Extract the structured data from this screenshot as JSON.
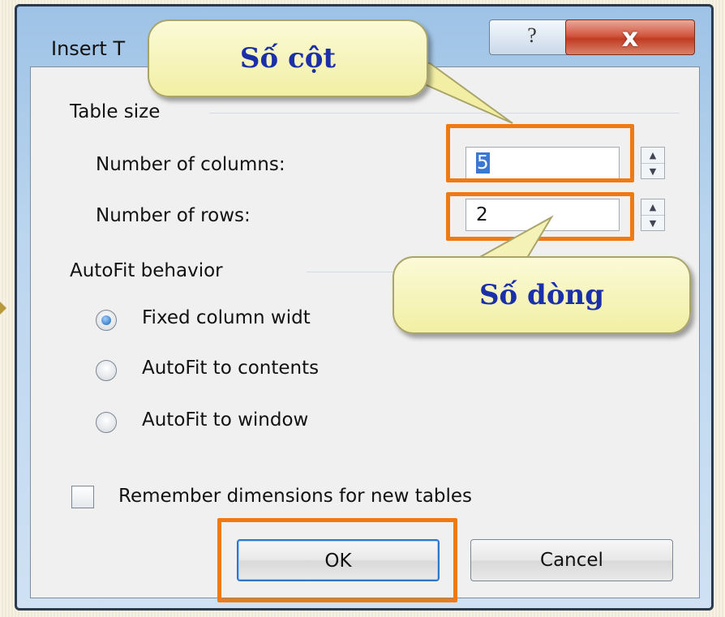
{
  "dialog": {
    "title": "Insert T",
    "help_glyph": "?",
    "close_glyph": "x"
  },
  "table_size": {
    "group_label": "Table size",
    "columns_label": "Number of columns:",
    "columns_value": "5",
    "rows_label": "Number of rows:",
    "rows_value": "2"
  },
  "autofit": {
    "group_label": "AutoFit behavior",
    "options": [
      {
        "label": "Fixed column widt",
        "selected": true
      },
      {
        "label": "AutoFit to contents",
        "selected": false
      },
      {
        "label": "AutoFit to window",
        "selected": false
      }
    ]
  },
  "remember": {
    "label": "Remember dimensions for new tables",
    "checked": false
  },
  "buttons": {
    "ok": "OK",
    "cancel": "Cancel"
  },
  "callouts": {
    "columns": "Số cột",
    "rows": "Số dòng"
  },
  "colors": {
    "highlight": "#f07a12",
    "callout_text": "#1a2fa8",
    "callout_fill": "#f2efa5"
  }
}
